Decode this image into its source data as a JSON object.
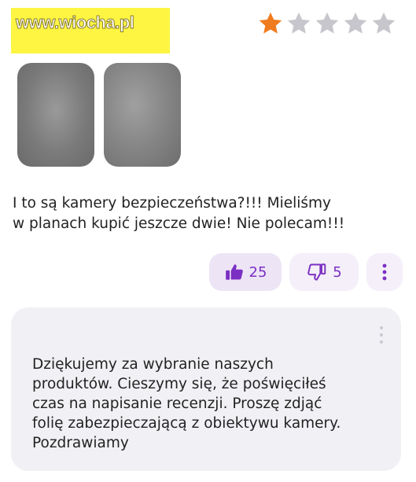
{
  "watermark": "www.wiocha.pl",
  "rating": {
    "value": 1,
    "max": 5,
    "filled_color": "#f07b1e",
    "empty_color": "#c6c6cc"
  },
  "photos": [
    "photo-1",
    "photo-2"
  ],
  "review": {
    "line1": "I to są kamery bezpieczeństwa?!!! Mieliśmy",
    "line2": "w planach kupić jeszcze dwie! Nie polecam!!!"
  },
  "actions": {
    "likes": "25",
    "dislikes": "5",
    "accent_color": "#7b2fc3"
  },
  "reply": {
    "line1": "Dziękujemy za wybranie naszych",
    "line2": "produktów. Cieszymy się, że poświęciłeś",
    "line3": "czas na napisanie recenzji. Proszę zdjąć",
    "line4": "folię zabezpieczającą z obiektywu kamery.",
    "line5": "Pozdrawiamy"
  }
}
